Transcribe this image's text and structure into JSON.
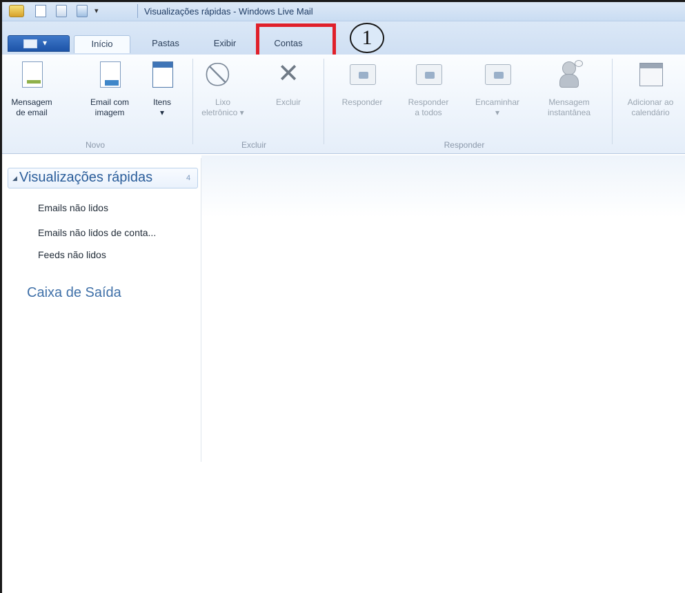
{
  "window": {
    "title": "Visualizações rápidas - Windows Live Mail",
    "quick_access_dropdown": "▾"
  },
  "tabs": {
    "file_menu_arrow": "▾",
    "items": [
      {
        "label": "Início",
        "active": true
      },
      {
        "label": "Pastas",
        "active": false
      },
      {
        "label": "Exibir",
        "active": false
      },
      {
        "label": "Contas",
        "active": false,
        "highlighted": true
      }
    ],
    "highlight_color": "#e0202a",
    "step_badge": "1"
  },
  "ribbon": {
    "groups": [
      {
        "label": "Novo",
        "buttons": [
          {
            "line1": "Mensagem",
            "line2": "de email",
            "icon": "email-message-icon",
            "enabled": true
          },
          {
            "line1": "Email com",
            "line2": "imagem",
            "icon": "photo-email-icon",
            "enabled": true
          },
          {
            "line1": "Itens",
            "line2": "▾",
            "icon": "calendar-items-icon",
            "enabled": true
          }
        ]
      },
      {
        "label": "Excluir",
        "buttons": [
          {
            "line1": "Lixo",
            "line2": "eletrônico ▾",
            "icon": "junk-icon",
            "enabled": false
          },
          {
            "line1": "Excluir",
            "line2": "",
            "icon": "delete-icon",
            "enabled": false
          }
        ]
      },
      {
        "label": "Responder",
        "buttons": [
          {
            "line1": "Responder",
            "line2": "",
            "icon": "reply-icon",
            "enabled": false
          },
          {
            "line1": "Responder",
            "line2": "a todos",
            "icon": "reply-all-icon",
            "enabled": false
          },
          {
            "line1": "Encaminhar",
            "line2": "▾",
            "icon": "forward-icon",
            "enabled": false
          },
          {
            "line1": "Mensagem",
            "line2": "instantânea",
            "icon": "instant-message-icon",
            "enabled": false
          }
        ]
      },
      {
        "label": "",
        "buttons": [
          {
            "line1": "Adicionar ao",
            "line2": "calendário",
            "icon": "add-to-calendar-icon",
            "enabled": false
          }
        ]
      }
    ]
  },
  "sidebar": {
    "quick_views_title": "Visualizações rápidas",
    "quick_views_count": "4",
    "items": [
      {
        "label": "Emails não lidos"
      },
      {
        "label": "Emails não lidos de conta..."
      },
      {
        "label": "Feeds não lidos"
      }
    ],
    "outbox_label": "Caixa de Saída"
  }
}
